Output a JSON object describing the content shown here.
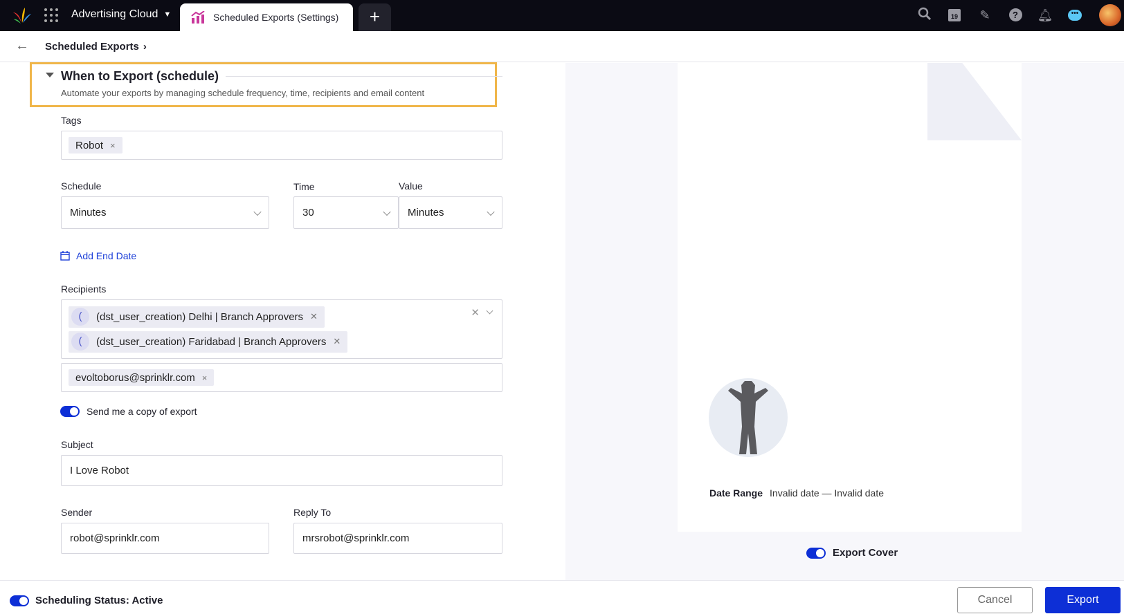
{
  "topbar": {
    "app_name": "Advertising Cloud",
    "tab_label": "Scheduled Exports (Settings)",
    "add_tab": "+",
    "calendar_day": "19",
    "icons": [
      "search-icon",
      "calendar-icon",
      "pencil-icon",
      "help-icon",
      "bell-icon",
      "chat-icon",
      "avatar"
    ]
  },
  "breadcrumb": {
    "label": "Scheduled Exports",
    "chevron": "›"
  },
  "section": {
    "title": "When to Export (schedule)",
    "subtitle": "Automate your exports by managing schedule frequency, time, recipients and email content"
  },
  "form": {
    "tags_label": "Tags",
    "tags": [
      "Robot"
    ],
    "schedule_label": "Schedule",
    "schedule_value": "Minutes",
    "time_label": "Time",
    "time_value": "30",
    "value_label": "Value",
    "value_value": "Minutes",
    "add_end_date": "Add End Date",
    "recipients_label": "Recipients",
    "recipients": [
      {
        "initial": "(",
        "name": "(dst_user_creation) Delhi | Branch Approvers"
      },
      {
        "initial": "(",
        "name": "(dst_user_creation) Faridabad | Branch Approvers"
      }
    ],
    "emails": [
      "evoltoborus@sprinklr.com"
    ],
    "send_copy_label": "Send me a copy of export",
    "send_copy_on": true,
    "subject_label": "Subject",
    "subject_value": "I Love Robot",
    "sender_label": "Sender",
    "sender_value": "robot@sprinklr.com",
    "reply_to_label": "Reply To",
    "reply_to_value": "mrsrobot@sprinklr.com"
  },
  "preview": {
    "date_range_label": "Date Range",
    "date_range_value": "Invalid date — Invalid date",
    "export_cover_label": "Export Cover",
    "export_cover_on": true
  },
  "footer": {
    "status_label": "Scheduling Status: Active",
    "status_on": true,
    "cancel": "Cancel",
    "export": "Export"
  },
  "colors": {
    "accent": "#0d2fd6",
    "highlight": "#f0b64a",
    "topbar": "#0b0b14"
  }
}
